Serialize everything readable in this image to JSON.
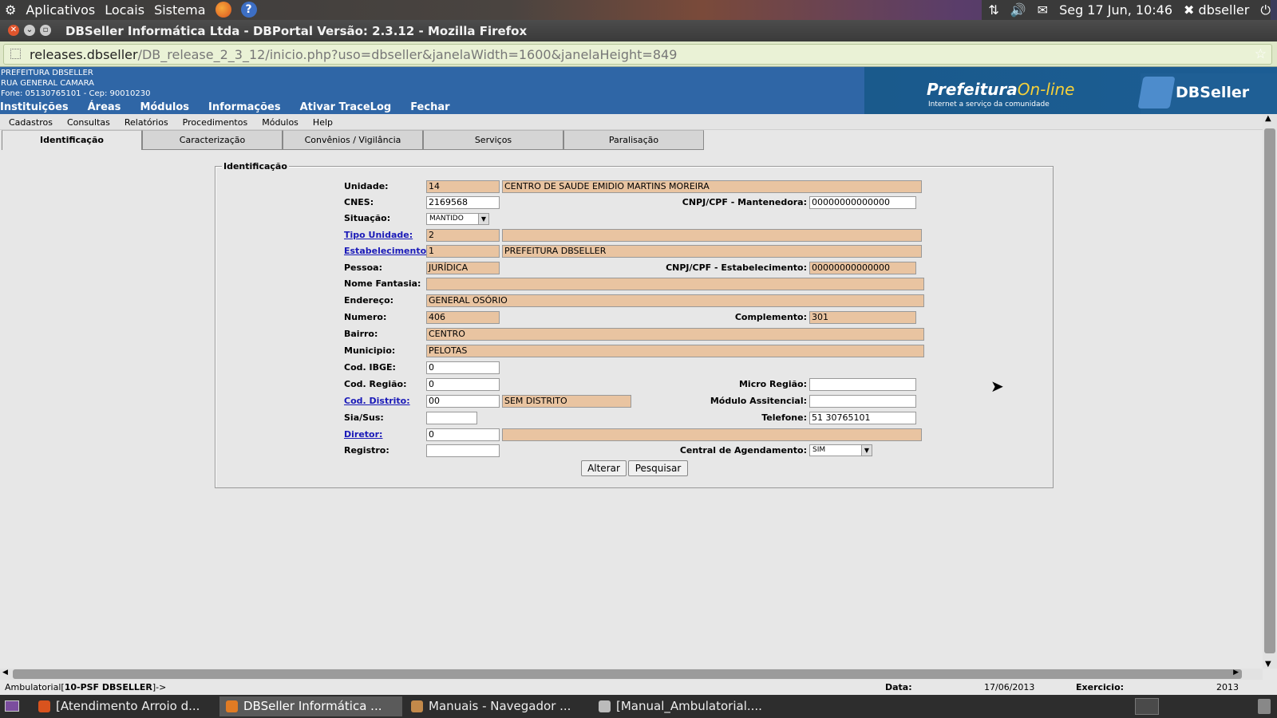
{
  "top_panel": {
    "menus": [
      "Aplicativos",
      "Locais",
      "Sistema"
    ],
    "clock": "Seg 17 Jun, 10:46",
    "user": "dbseller"
  },
  "window": {
    "title": "DBSeller Informática Ltda - DBPortal Versão: 2.3.12 - Mozilla Firefox"
  },
  "urlbar": {
    "host": "releases.dbseller",
    "path": "/DB_release_2_3_12/inicio.php?uso=dbseller&janelaWidth=1600&janelaHeight=849"
  },
  "header": {
    "org_name": "PREFEITURA DBSELLER",
    "org_address": "RUA GENERAL CAMARA",
    "org_phone": "Fone: 05130765101  -  Cep: 90010230",
    "menu": [
      "Instituições",
      "Áreas",
      "Módulos",
      "Informações",
      "Ativar TraceLog",
      "Fechar"
    ],
    "banner_pref": "Prefeitura",
    "banner_online": "On-line",
    "banner_slogan": "Internet a serviço da comunidade",
    "banner_brand": "DBSeller"
  },
  "submenu": [
    "Cadastros",
    "Consultas",
    "Relatórios",
    "Procedimentos",
    "Módulos",
    "Help"
  ],
  "tabs": [
    "Identificação",
    "Caracterização",
    "Convênios / Vigilância",
    "Serviços",
    "Paralisação"
  ],
  "form": {
    "legend": "Identificação",
    "labels": {
      "unidade": "Unidade:",
      "cnes": "CNES:",
      "cnpj_mant": "CNPJ/CPF - Mantenedora:",
      "situacao": "Situação:",
      "tipo_unidade": "Tipo Unidade:",
      "estabelecimento": "Estabelecimento:",
      "pessoa": "Pessoa:",
      "cnpj_estab": "CNPJ/CPF - Estabelecimento:",
      "nome_fantasia": "Nome Fantasia:",
      "endereco": "Endereço:",
      "numero": "Numero:",
      "complemento": "Complemento:",
      "bairro": "Bairro:",
      "municipio": "Municipio:",
      "cod_ibge": "Cod. IBGE:",
      "cod_regiao": "Cod. Região:",
      "micro_regiao": "Micro Região:",
      "cod_distrito": "Cod. Distrito:",
      "modulo_assist": "Módulo Assitencial:",
      "sia_sus": "Sia/Sus:",
      "telefone": "Telefone:",
      "diretor": "Diretor:",
      "registro": "Registro:",
      "central": "Central de Agendamento:"
    },
    "values": {
      "unidade": "14",
      "unidade_nome": "CENTRO DE SAUDE EMIDIO MARTINS MOREIRA",
      "cnes": "2169568",
      "cnpj_mant": "00000000000000",
      "situacao": "MANTIDO",
      "tipo_unidade": "2",
      "tipo_unidade_desc": "",
      "estabelecimento": "1",
      "estabelecimento_nome": "PREFEITURA DBSELLER",
      "pessoa": "JURÍDICA",
      "cnpj_estab": "00000000000000",
      "nome_fantasia": "",
      "endereco": "GENERAL OSÓRIO",
      "numero": "406",
      "complemento": "301",
      "bairro": "CENTRO",
      "municipio": "PELOTAS",
      "cod_ibge": "0",
      "cod_regiao": "0",
      "micro_regiao": "",
      "cod_distrito": "00",
      "distrito_nome": "SEM DISTRITO",
      "modulo_assist": "",
      "sia_sus": "",
      "telefone": "51 30765101",
      "diretor": "0",
      "diretor_nome": "",
      "registro": "",
      "central": "SIM"
    },
    "buttons": {
      "alterar": "Alterar",
      "pesquisar": "Pesquisar"
    }
  },
  "status": {
    "left_prefix": "Ambulatorial[",
    "left_bold": "10-PSF DBSELLER",
    "left_suffix": "]->",
    "data_label": "Data:",
    "data_value": "17/06/2013",
    "exercicio_label": "Exercicio:",
    "exercicio_value": "2013"
  },
  "taskbar": [
    "[Atendimento Arroio d...",
    "DBSeller Informática ...",
    "Manuais - Navegador ...",
    "[Manual_Ambulatorial...."
  ]
}
